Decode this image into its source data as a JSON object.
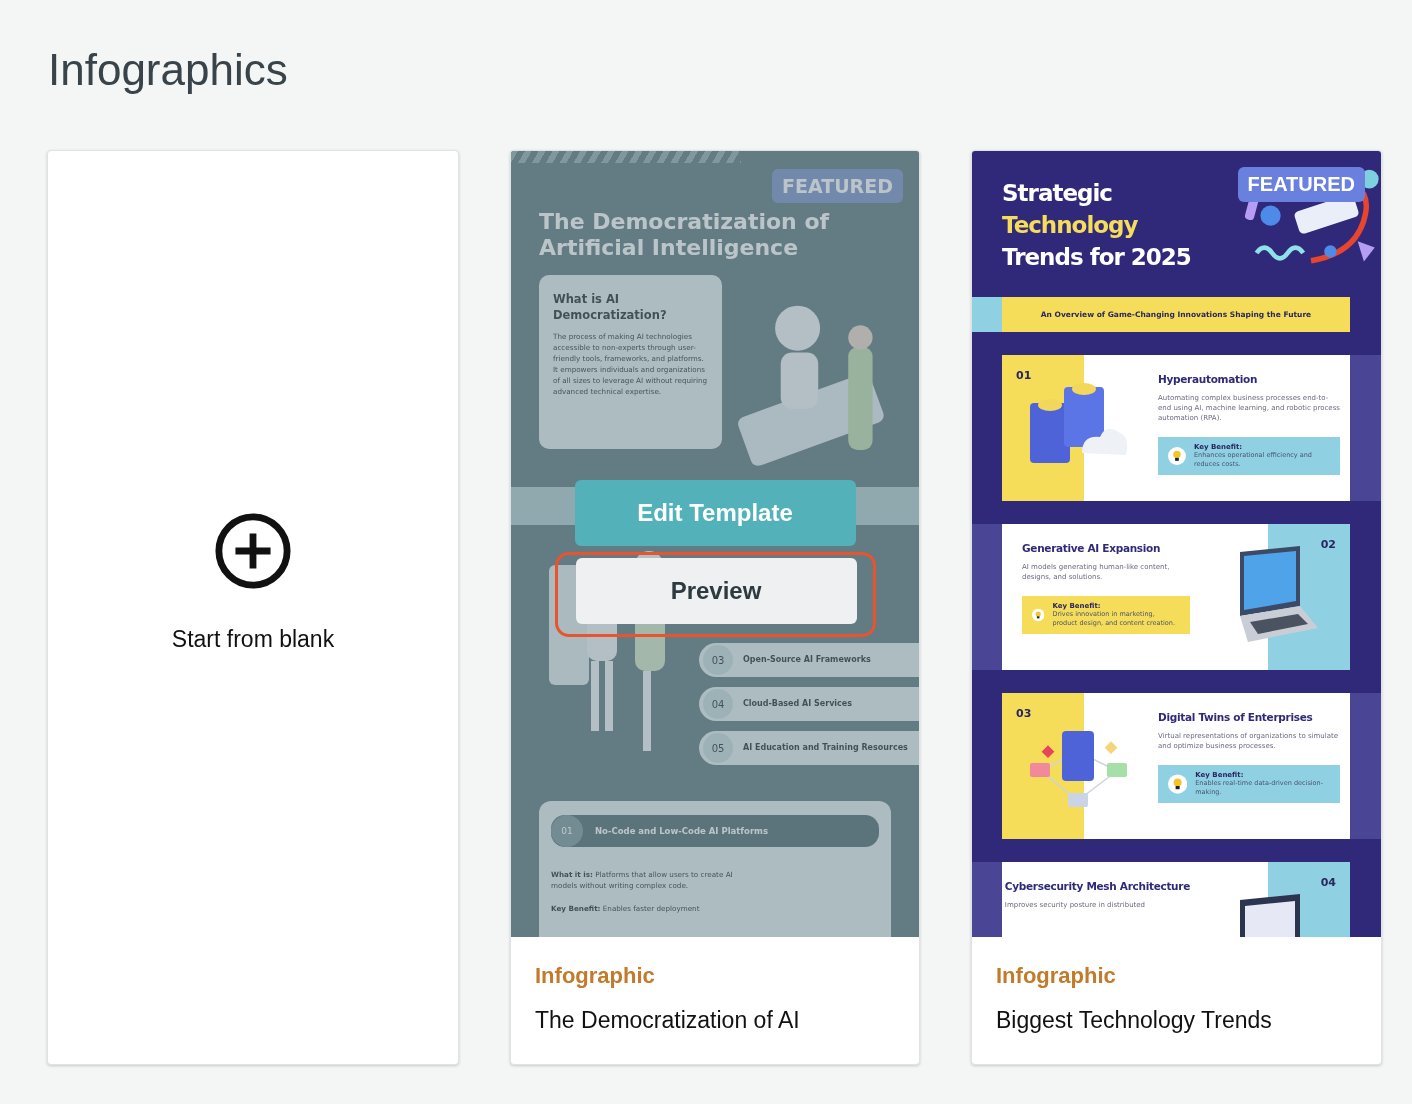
{
  "page_title": "Infographics",
  "blank_card": {
    "label": "Start from blank"
  },
  "templates": [
    {
      "kind": "democratization",
      "hovered": true,
      "category": "Infographic",
      "name": "The Democratization of AI",
      "thumbnail": {
        "badge": "FEATURED",
        "title": "The Democratization of Artificial Intelligence",
        "intro": {
          "heading": "What is AI Democratization?",
          "text": "The process of making AI technologies accessible to non-experts through user-friendly tools, frameworks, and platforms. It empowers individuals and organizations of all sizes to leverage AI without requiring advanced technical expertise."
        },
        "steps": [
          {
            "number": "03",
            "label": "Open-Source AI Frameworks"
          },
          {
            "number": "04",
            "label": "Cloud-Based AI Services"
          },
          {
            "number": "05",
            "label": "AI Education and Training Resources"
          }
        ],
        "section": {
          "number": "01",
          "heading": "No-Code and Low-Code AI Platforms",
          "what": "**What it is:** Platforms that allow users to create AI models without writing complex code.",
          "benefit": "**Key Benefit:** Enables faster deployment"
        }
      },
      "actions": [
        {
          "kind": "primary",
          "label": "Edit Template",
          "focused": false
        },
        {
          "kind": "secondary",
          "label": "Preview",
          "focused": true
        }
      ]
    },
    {
      "kind": "tech-trends",
      "hovered": false,
      "category": "Infographic",
      "name": "Biggest Technology Trends",
      "thumbnail": {
        "badge": "FEATURED",
        "title_lines": [
          {
            "text": "Strategic",
            "highlight": false
          },
          {
            "text": "Technology",
            "highlight": true
          },
          {
            "text": "Trends for 2025",
            "highlight": false
          }
        ],
        "subtitle": "An Overview of Game-Changing Innovations Shaping the Future",
        "items": [
          {
            "kind": "servers",
            "mirrored": false,
            "number": "01",
            "title": "Hyperautomation",
            "text": "Automating complex business processes end-to-end using AI, machine learning, and robotic process automation (RPA).",
            "benefit_label": "Key Benefit:",
            "benefit": "Enhances operational efficiency and reduces costs."
          },
          {
            "kind": "laptop",
            "mirrored": true,
            "number": "02",
            "title": "Generative AI Expansion",
            "text": "AI models generating human-like content, designs, and solutions.",
            "benefit_label": "Key Benefit:",
            "benefit": "Drives innovation in marketing, product design, and content creation."
          },
          {
            "kind": "network",
            "mirrored": false,
            "number": "03",
            "title": "Digital Twins of Enterprises",
            "text": "Virtual representations of organizations to simulate and optimize business processes.",
            "benefit_label": "Key Benefit:",
            "benefit": "Enables real-time data-driven decision-making."
          },
          {
            "kind": "monitor",
            "mirrored": true,
            "number": "04",
            "title": "Cybersecurity Mesh Architecture",
            "text": "Improves security posture in distributed"
          }
        ]
      }
    }
  ]
}
